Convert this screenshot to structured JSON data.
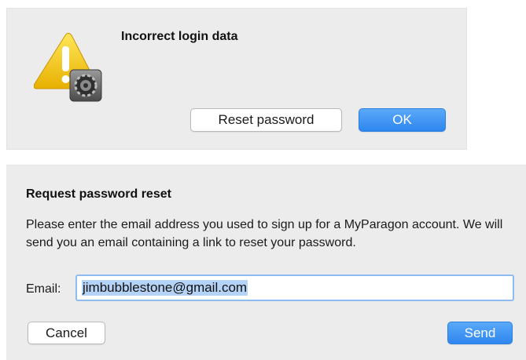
{
  "alert": {
    "title": "Incorrect login data",
    "icon": "warning-icon",
    "badge_icon": "gear-icon",
    "buttons": {
      "reset": "Reset password",
      "ok": "OK"
    }
  },
  "reset_dialog": {
    "title": "Request password reset",
    "message": "Please enter the email address you used to sign up for a MyParagon account. We will send you an email containing a link to reset your password.",
    "email_label": "Email:",
    "email_value": "jimbubblestone@gmail.com",
    "buttons": {
      "cancel": "Cancel",
      "send": "Send"
    }
  },
  "colors": {
    "dialog_bg": "#ececec",
    "primary_button": "#3a8ff2",
    "selection": "#b5d3f6",
    "warning": "#f2c200"
  }
}
